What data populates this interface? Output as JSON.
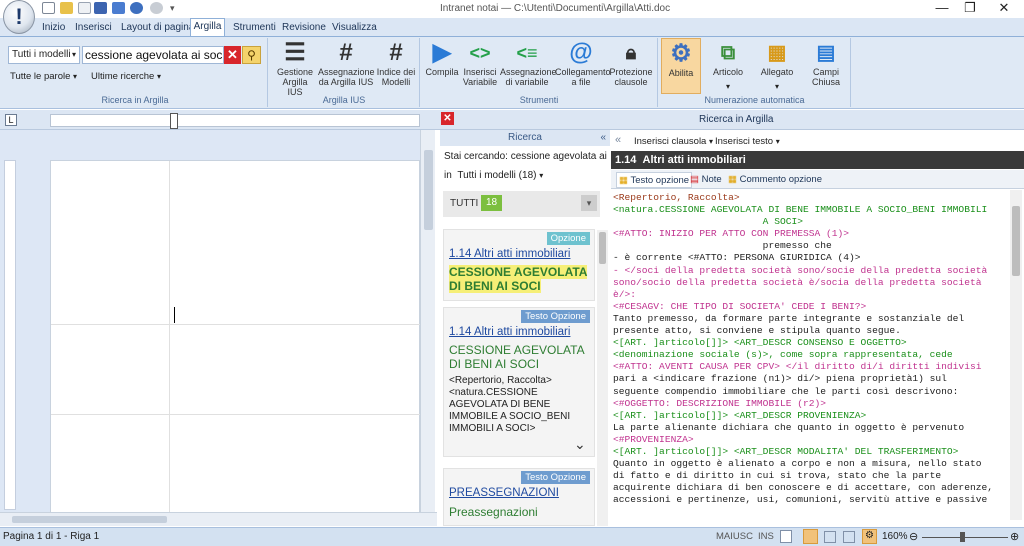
{
  "window": {
    "title": "Intranet notai — C:\\Utenti\\Documenti\\Argilla\\Atti.docx"
  },
  "tabs": [
    "Inizio",
    "Inserisci",
    "Layout di pagina",
    "Argilla",
    "Strumenti",
    "Revisione",
    "Visualizza"
  ],
  "ribbon": {
    "search": {
      "scope": "Tutti i modelli",
      "value": "cessione agevolata ai soci",
      "words_mode": "Tutte le parole",
      "recent": "Ultime ricerche",
      "group_label": "Ricerca in Argilla"
    },
    "ius": {
      "group_label": "Argilla IUS",
      "buttons": [
        {
          "label": "Gestione Argilla IUS",
          "icon": "bars-icon"
        },
        {
          "label": "Assegnazione da Argilla IUS",
          "icon": "hash-icon"
        },
        {
          "label": "Indice dei Modelli",
          "icon": "hash-icon"
        }
      ]
    },
    "tools": {
      "group_label": "Strumenti",
      "buttons": [
        {
          "label": "Compila",
          "icon": "play-icon"
        },
        {
          "label": "Inserisci Variabile",
          "icon": "code-icon"
        },
        {
          "label": "Assegnazione di variabile",
          "icon": "code-list-icon"
        },
        {
          "label": "Collegamento a file",
          "icon": "attachment-icon"
        },
        {
          "label": "Protezione clausole",
          "icon": "lock-icon"
        }
      ]
    },
    "numbering": {
      "group_label": "Numerazione automatica",
      "buttons": [
        {
          "label": "Abilita",
          "icon": "gear-icon"
        },
        {
          "label": "Articolo",
          "icon": "hierarchy-icon"
        },
        {
          "label": "Allegato",
          "icon": "blocks-icon"
        },
        {
          "label": "Campi Chiusa",
          "icon": "form-icon"
        }
      ]
    }
  },
  "panel": {
    "title": "Ricerca in Argilla",
    "results_header": "Ricerca",
    "searching_label": "Stai cercando:",
    "searching_value": "cessione agevolata ai",
    "in_label": "in",
    "in_scope": "Tutti i modelli (18)",
    "all_label": "TUTTI",
    "all_count": "18",
    "results": [
      {
        "badge": "Opzione",
        "link": "1.14 Altri atti immobiliari",
        "title": "CESSIONE AGEVOLATA DI BENI AI SOCI"
      },
      {
        "badge": "Testo Opzione",
        "link": "1.14 Altri atti immobiliari",
        "title": "CESSIONE AGEVOLATA DI BENI AI SOCI",
        "snippet": "<Repertorio, Raccolta> <natura.CESSIONE AGEVOLATA DI BENE IMMOBILE A SOCIO_BENI IMMOBILI A SOCI>"
      },
      {
        "badge": "Testo Opzione",
        "link": "PREASSEGNAZIONI",
        "title": "Preassegnazioni"
      }
    ]
  },
  "editor": {
    "insert_clause": "Inserisci clausola",
    "insert_text": "Inserisci testo",
    "heading_num": "1.14",
    "heading_title": "Altri atti immobiliari",
    "tabs": [
      "Testo opzione",
      "Note",
      "Commento opzione"
    ],
    "code_lines": [
      "<Repertorio, Raccolta>",
      "",
      "<natura.CESSIONE AGEVOLATA DI BENE IMMOBILE A SOCIO_BENI IMMOBILI",
      "                          A SOCI>",
      "<#ATTO: INIZIO PER ATTO CON PREMESSA (1)>",
      "                          premesso che",
      "- è corrente <#ATTO: PERSONA GIURIDICA (4)>",
      "- </soci della predetta società sono/socie della predetta società",
      "sono/socio della predetta società è/socia della predetta società",
      "è/>:",
      "<#CESAGV: CHE TIPO DI SOCIETA' CEDE I BENI?>",
      "Tanto premesso, da formare parte integrante e sostanziale del",
      "presente atto, si conviene e stipula quanto segue.",
      "<[ART. ]articolo[]]> <ART_DESCR CONSENSO E OGGETTO>",
      "<denominazione sociale (s)>, come sopra rappresentata, cede",
      "<#ATTO: AVENTI CAUSA PER CPV> </il diritto di/i diritti indivisi",
      "pari a <indicare frazione (n1)> di/> piena proprietà1) sul",
      "seguente compendio immobiliare che le parti così descrivono:",
      "<#OGGETTO: DESCRIZIONE IMMOBILE (r2)>",
      "<[ART. ]articolo[]]> <ART_DESCR PROVENIENZA>",
      "La parte alienante dichiara che quanto in oggetto è pervenuto",
      "<#PROVENIENZA>",
      "<[ART. ]articolo[]]> <ART_DESCR MODALITA' DEL TRASFERIMENTO>",
      "Quanto in oggetto è alienato a corpo e non a misura, nello stato",
      "di fatto e di diritto in cui si trova, stato che la parte",
      "acquirente dichiara di ben conoscere e di accettare, con aderenze,",
      "accessioni e pertinenze, usi, comunioni, servitù attive e passive"
    ]
  },
  "status": {
    "page": "Pagina 1 di 1 - Riga 1",
    "caps": "MAIUSC",
    "ins": "INS",
    "zoom": "160%"
  },
  "colors": {
    "accent": "#2e7d32",
    "link": "#1f4aa0",
    "highlight": "#f6ef77",
    "ribbon": "#dfe9f5"
  }
}
